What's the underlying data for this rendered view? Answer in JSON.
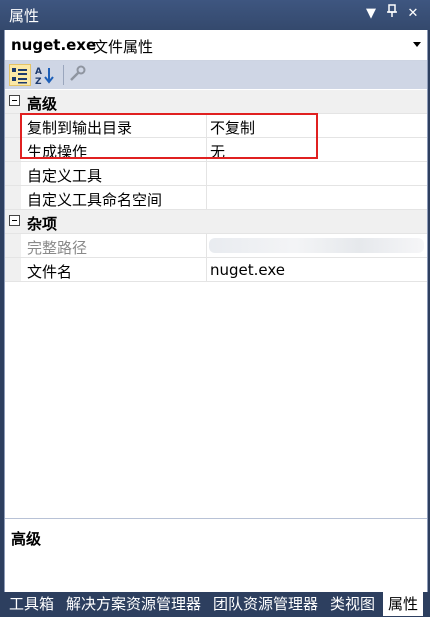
{
  "window": {
    "title": "属性",
    "buttons": {
      "dropdown": "▼",
      "pin": "ᛘ",
      "close": "✕"
    }
  },
  "object_selector": {
    "name": "nuget.exe",
    "type": "文件属性"
  },
  "toolbar": {
    "icons": [
      "categorized-icon",
      "alphabetical-icon",
      "property-pages-icon"
    ]
  },
  "grid": {
    "categories": [
      {
        "label": "高级",
        "rows": [
          {
            "name": "复制到输出目录",
            "value": "不复制"
          },
          {
            "name": "生成操作",
            "value": "无"
          },
          {
            "name": "自定义工具",
            "value": ""
          },
          {
            "name": "自定义工具命名空间",
            "value": ""
          }
        ]
      },
      {
        "label": "杂项",
        "rows": [
          {
            "name": "完整路径",
            "value": ""
          },
          {
            "name": "文件名",
            "value": "nuget.exe"
          }
        ]
      }
    ]
  },
  "description": {
    "title": "高级"
  },
  "tabs": [
    "工具箱",
    "解决方案资源管理器",
    "团队资源管理器",
    "类视图",
    "属性"
  ],
  "colors": {
    "accent_frame": "#2d3f5f",
    "highlight": "#e02020",
    "toolbar_bg": "#cfd6e5"
  }
}
